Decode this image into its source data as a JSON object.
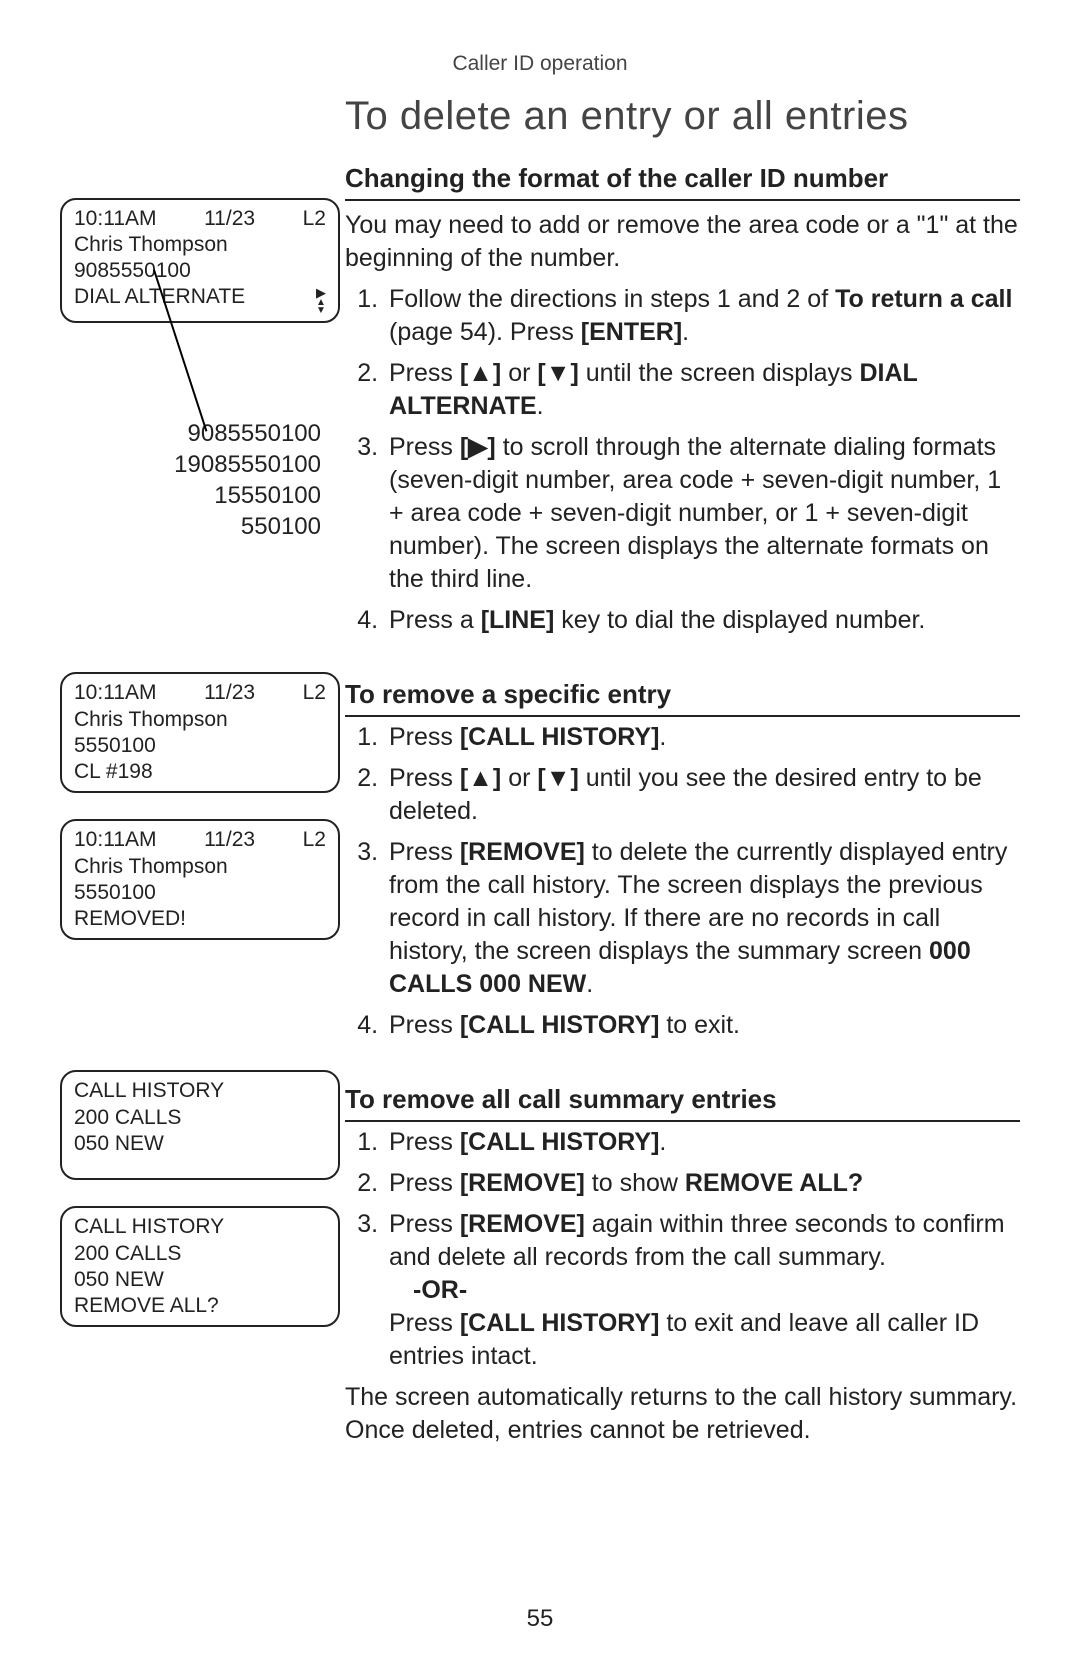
{
  "breadcrumb": "Caller ID operation",
  "title": "To delete an entry or all entries",
  "page_number": "55",
  "section1": {
    "heading": "Changing the format of the caller ID number",
    "intro": "You may need to add or remove the area code or a \"1\" at the beginning of the number.",
    "step1_a": "Follow the directions in steps 1 and 2 of ",
    "step1_b": "To return a call",
    "step1_c": " (page 54). Press ",
    "step1_d": "[ENTER]",
    "step1_e": ".",
    "step2_a": "Press ",
    "step2_b": "[▲]",
    "step2_c": " or ",
    "step2_d": "[▼]",
    "step2_e": " until the screen displays ",
    "step2_f": "DIAL ALTERNATE",
    "step2_g": ".",
    "step3_a": "Press ",
    "step3_b": "[▶]",
    "step3_c": " to scroll through the alternate dialing formats (seven-digit number, area code + seven-digit number, 1 + area code + seven-digit number, or 1 + seven-digit number). The screen displays the alternate formats on the third line.",
    "step4_a": "Press a ",
    "step4_b": "[LINE]",
    "step4_c": " key to dial the displayed number."
  },
  "section2": {
    "heading": "To remove a specific entry",
    "step1_a": "Press ",
    "step1_b": "[CALL HISTORY]",
    "step1_c": ".",
    "step2_a": "Press ",
    "step2_b": "[▲]",
    "step2_c": " or ",
    "step2_d": "[▼]",
    "step2_e": " until you see the desired entry to be deleted.",
    "step3_a": "Press ",
    "step3_b": "[REMOVE]",
    "step3_c": " to delete the currently displayed entry from the call history.  The screen displays the previous record in call history. If there are no records in call history, the screen displays the summary screen ",
    "step3_d": "000 CALLS 000 NEW",
    "step3_e": ".",
    "step4_a": "Press ",
    "step4_b": "[CALL HISTORY]",
    "step4_c": " to exit."
  },
  "section3": {
    "heading": "To remove all call summary entries",
    "step1_a": "Press ",
    "step1_b": "[CALL HISTORY]",
    "step1_c": ".",
    "step2_a": "Press ",
    "step2_b": "[REMOVE]",
    "step2_c": " to show ",
    "step2_d": "REMOVE ALL?",
    "step3_a": "Press ",
    "step3_b": "[REMOVE]",
    "step3_c": " again within three seconds to confirm and delete all records from the call summary.",
    "or": "-OR-",
    "step3_alt_a": "Press ",
    "step3_alt_b": "[CALL HISTORY]",
    "step3_alt_c": " to exit and leave all caller ID entries intact.",
    "outro": "The screen automatically returns to the call history summary. Once deleted, entries cannot be retrieved."
  },
  "lcd1": {
    "time": "10:11AM",
    "date": "11/23",
    "line": "L2",
    "name": "Chris Thompson",
    "number": "9085550100",
    "status": "DIAL ALTERNATE",
    "icon_right": "▶",
    "icon_updown": "▲\n▼"
  },
  "alt_numbers": {
    "n1": "9085550100",
    "n2": "19085550100",
    "n3": "15550100",
    "n4": "550100"
  },
  "lcd2": {
    "time": "10:11AM",
    "date": "11/23",
    "line": "L2",
    "name": "Chris Thompson",
    "number": "5550100",
    "status": "CL #198"
  },
  "lcd3": {
    "time": "10:11AM",
    "date": "11/23",
    "line": "L2",
    "name": "Chris Thompson",
    "number": "5550100",
    "status": "REMOVED!"
  },
  "lcd4": {
    "l1": "CALL HISTORY",
    "l2": "200 CALLS",
    "l3": "050 NEW",
    "l4": " "
  },
  "lcd5": {
    "l1": "CALL HISTORY",
    "l2": "200 CALLS",
    "l3": "050 NEW",
    "l4": "REMOVE ALL?"
  }
}
